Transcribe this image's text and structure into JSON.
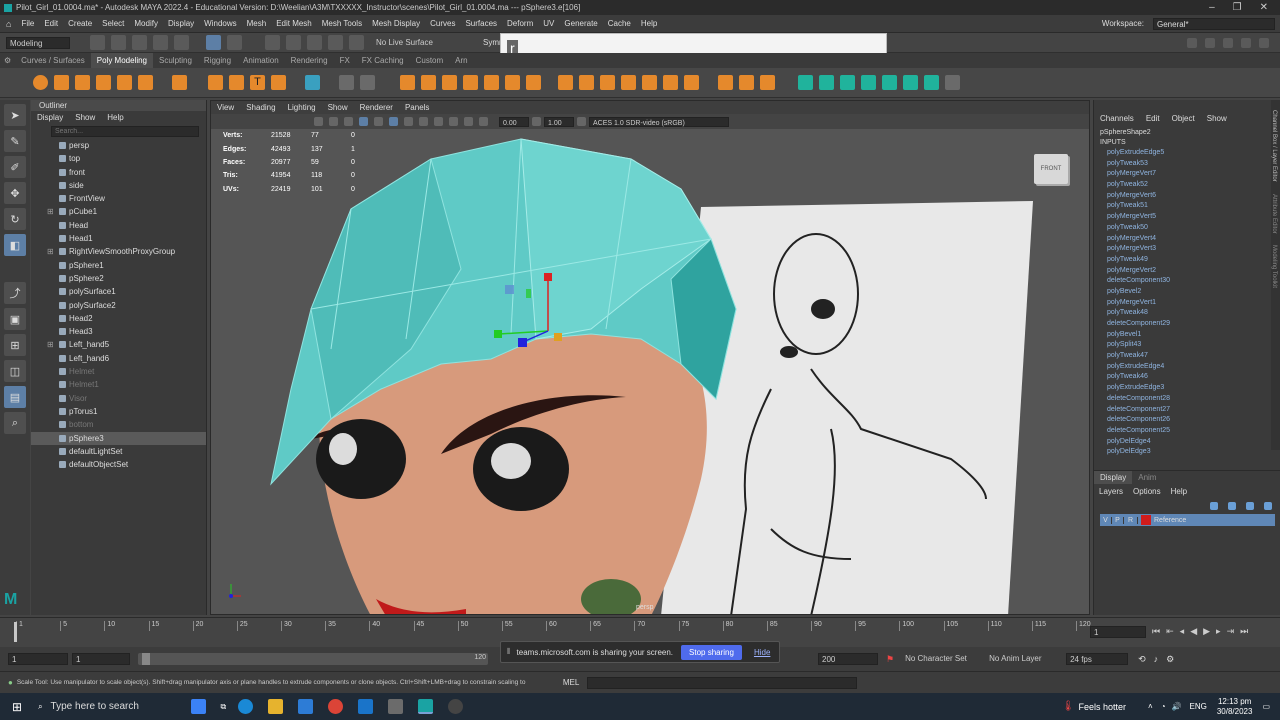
{
  "title": "Pilot_Girl_01.0004.ma* - Autodesk MAYA 2022.4 - Educational Version: D:\\Weelian\\A3M\\TXXXXX_Instructor\\scenes\\Pilot_Girl_01.0004.ma  ---  pSphere3.e[106]",
  "menus": [
    "File",
    "Edit",
    "Create",
    "Select",
    "Modify",
    "Display",
    "Windows",
    "Mesh",
    "Edit Mesh",
    "Mesh Tools",
    "Mesh Display",
    "Curves",
    "Surfaces",
    "Deform",
    "UV",
    "Generate",
    "Cache",
    "Help"
  ],
  "workspace_label": "Workspace:",
  "workspace_value": "General*",
  "mode_select": "Modeling",
  "live_surface": "No Live Surface",
  "symmetry": "Symmet",
  "popup_text": "r",
  "shelf_tabs": [
    "Curves / Surfaces",
    "Poly Modeling",
    "Sculpting",
    "Rigging",
    "Animation",
    "Rendering",
    "FX",
    "FX Caching",
    "Custom",
    "Arn"
  ],
  "active_shelf": "Poly Modeling",
  "outliner": {
    "title": "Outliner",
    "menu": [
      "Display",
      "Show",
      "Help"
    ],
    "search_placeholder": "Search...",
    "items": [
      {
        "label": "persp",
        "dim": false,
        "exp": false,
        "sel": false
      },
      {
        "label": "top",
        "dim": false,
        "exp": false,
        "sel": false
      },
      {
        "label": "front",
        "dim": false,
        "exp": false,
        "sel": false
      },
      {
        "label": "side",
        "dim": false,
        "exp": false,
        "sel": false
      },
      {
        "label": "FrontView",
        "dim": false,
        "exp": false,
        "sel": false
      },
      {
        "label": "pCube1",
        "dim": false,
        "exp": true,
        "sel": false
      },
      {
        "label": "Head",
        "dim": false,
        "exp": false,
        "sel": false
      },
      {
        "label": "Head1",
        "dim": false,
        "exp": false,
        "sel": false
      },
      {
        "label": "RightViewSmoothProxyGroup",
        "dim": false,
        "exp": true,
        "sel": false
      },
      {
        "label": "pSphere1",
        "dim": false,
        "exp": false,
        "sel": false
      },
      {
        "label": "pSphere2",
        "dim": false,
        "exp": false,
        "sel": false
      },
      {
        "label": "polySurface1",
        "dim": false,
        "exp": false,
        "sel": false
      },
      {
        "label": "polySurface2",
        "dim": false,
        "exp": false,
        "sel": false
      },
      {
        "label": "Head2",
        "dim": false,
        "exp": false,
        "sel": false
      },
      {
        "label": "Head3",
        "dim": false,
        "exp": false,
        "sel": false
      },
      {
        "label": "Left_hand5",
        "dim": false,
        "exp": true,
        "sel": false
      },
      {
        "label": "Left_hand6",
        "dim": false,
        "exp": false,
        "sel": false
      },
      {
        "label": "Helmet",
        "dim": true,
        "exp": false,
        "sel": false
      },
      {
        "label": "Helmet1",
        "dim": true,
        "exp": false,
        "sel": false
      },
      {
        "label": "Visor",
        "dim": true,
        "exp": false,
        "sel": false
      },
      {
        "label": "pTorus1",
        "dim": false,
        "exp": false,
        "sel": false
      },
      {
        "label": "bottom",
        "dim": true,
        "exp": false,
        "sel": false
      },
      {
        "label": "pSphere3",
        "dim": false,
        "exp": false,
        "sel": true
      },
      {
        "label": "defaultLightSet",
        "dim": false,
        "exp": false,
        "sel": false
      },
      {
        "label": "defaultObjectSet",
        "dim": false,
        "exp": false,
        "sel": false
      }
    ]
  },
  "viewport": {
    "menu": [
      "View",
      "Shading",
      "Lighting",
      "Show",
      "Renderer",
      "Panels"
    ],
    "field_a": "0.00",
    "field_b": "1.00",
    "colorspace": "ACES 1.0 SDR-video (sRGB)",
    "camera_label": "persp",
    "cube_label": "FRONT",
    "hud": [
      {
        "k": "Verts:",
        "a": "21528",
        "b": "77",
        "c": "0"
      },
      {
        "k": "Edges:",
        "a": "42493",
        "b": "137",
        "c": "1"
      },
      {
        "k": "Faces:",
        "a": "20977",
        "b": "59",
        "c": "0"
      },
      {
        "k": "Tris:",
        "a": "41954",
        "b": "118",
        "c": "0"
      },
      {
        "k": "UVs:",
        "a": "22419",
        "b": "101",
        "c": "0"
      }
    ]
  },
  "channel_box": {
    "menu": [
      "Channels",
      "Edit",
      "Object",
      "Show"
    ],
    "shape": "pSphereShape2",
    "inputs_label": "INPUTS",
    "inputs": [
      "polyExtrudeEdge5",
      "polyTweak53",
      "polyMergeVert7",
      "polyTweak52",
      "polyMergeVert6",
      "polyTweak51",
      "polyMergeVert5",
      "polyTweak50",
      "polyMergeVert4",
      "polyMergeVert3",
      "polyTweak49",
      "polyMergeVert2",
      "deleteComponent30",
      "polyBevel2",
      "polyMergeVert1",
      "polyTweak48",
      "deleteComponent29",
      "polyBevel1",
      "polySplit43",
      "polyTweak47",
      "polyExtrudeEdge4",
      "polyTweak46",
      "polyExtrudeEdge3",
      "deleteComponent28",
      "deleteComponent27",
      "deleteComponent26",
      "deleteComponent25",
      "polyDelEdge4",
      "polyDelEdge3"
    ],
    "side_tabs": [
      "Channel Box / Layer Editor",
      "Attribute Editor",
      "Modeling Toolkit"
    ]
  },
  "layers": {
    "tabs": [
      "Display",
      "Anim"
    ],
    "menu": [
      "Layers",
      "Options",
      "Help"
    ],
    "layer_flags": [
      "V",
      "P",
      "R"
    ],
    "layer_name": "Reference",
    "layer_color": "#d01c1c"
  },
  "timeline": {
    "ticks": [
      "1",
      "5",
      "10",
      "15",
      "20",
      "25",
      "30",
      "35",
      "40",
      "45",
      "50",
      "55",
      "60",
      "65",
      "70",
      "75",
      "80",
      "85",
      "90",
      "95",
      "100",
      "105",
      "110",
      "115",
      "120"
    ],
    "current_frame": "1"
  },
  "range": {
    "start": "1",
    "start2": "1",
    "slider_end": "120",
    "end": "200",
    "character_set": "No Character Set",
    "anim_layer": "No Anim Layer",
    "fps": "24 fps"
  },
  "teams": {
    "message": "teams.microsoft.com is sharing your screen.",
    "stop": "Stop sharing",
    "hide": "Hide"
  },
  "help_line": "Scale Tool: Use manipulator to scale object(s). Shift+drag manipulator axis or plane handles to extrude components or clone objects. Ctrl+Shift+LMB+drag to constrain scaling to",
  "mel_label": "MEL",
  "taskbar": {
    "search_placeholder": "Type here to search",
    "weather": "Feels hotter",
    "lang": "ENG",
    "time": "12:13 pm",
    "date": "30/8/2023"
  }
}
